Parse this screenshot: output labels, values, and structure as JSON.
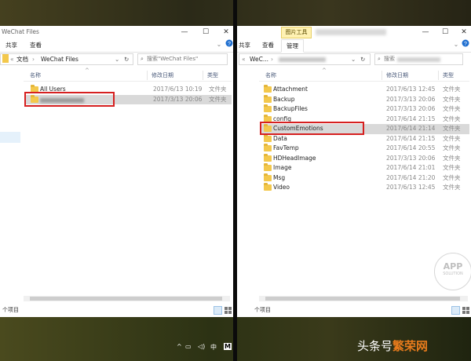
{
  "left_window": {
    "title": "WeChat Files",
    "ribbon_tabs": [
      "共享",
      "查看"
    ],
    "address": {
      "root": "文档",
      "folder": "WeChat Files"
    },
    "search_placeholder": "搜索\"WeChat Files\"",
    "columns": {
      "name": "名称",
      "date": "修改日期",
      "type": "类型"
    },
    "rows": [
      {
        "name": "All Users",
        "date": "2017/6/13 10:19",
        "type": "文件夹"
      },
      {
        "name": "",
        "date": "2017/3/13 20:06",
        "type": "文件夹"
      }
    ],
    "status": "个项目"
  },
  "right_window": {
    "context_tab": "图片工具",
    "ribbon_tabs": [
      "共享",
      "查看",
      "管理"
    ],
    "address": {
      "path": "WeC..."
    },
    "search_placeholder": "搜索",
    "columns": {
      "name": "名称",
      "date": "修改日期",
      "type": "类型"
    },
    "rows": [
      {
        "name": "Attachment",
        "date": "2017/6/13 12:45",
        "type": "文件夹"
      },
      {
        "name": "Backup",
        "date": "2017/3/13 20:06",
        "type": "文件夹"
      },
      {
        "name": "BackupFiles",
        "date": "2017/3/13 20:06",
        "type": "文件夹"
      },
      {
        "name": "config",
        "date": "2017/6/14 21:15",
        "type": "文件夹"
      },
      {
        "name": "CustomEmotions",
        "date": "2017/6/14 21:14",
        "type": "文件夹"
      },
      {
        "name": "Data",
        "date": "2017/6/14 21:15",
        "type": "文件夹"
      },
      {
        "name": "FavTemp",
        "date": "2017/6/14 20:55",
        "type": "文件夹"
      },
      {
        "name": "HDHeadImage",
        "date": "2017/3/13 20:06",
        "type": "文件夹"
      },
      {
        "name": "Image",
        "date": "2017/6/14 21:01",
        "type": "文件夹"
      },
      {
        "name": "Msg",
        "date": "2017/6/14 21:20",
        "type": "文件夹"
      },
      {
        "name": "Video",
        "date": "2017/6/13 12:45",
        "type": "文件夹"
      }
    ],
    "status": "个项目"
  },
  "watermark": {
    "big": "APP",
    "small": "SOLUTION"
  },
  "taskbar": {
    "ime": "中",
    "badge": "M"
  },
  "toutiao": {
    "prefix": "头条号",
    "name": "繁荣网"
  },
  "icons": [
    "folder-icon",
    "minimize-icon",
    "maximize-icon",
    "close-icon",
    "refresh-icon",
    "search-icon",
    "help-icon",
    "expand-icon",
    "details-view-icon",
    "thumbnail-view-icon",
    "speaker-icon",
    "wifi-icon"
  ],
  "colors": {
    "folder": "#f3c84c",
    "highlight_box": "#d62020",
    "selected_row": "#d9d9d9",
    "context_tab": "#fff2b3"
  }
}
